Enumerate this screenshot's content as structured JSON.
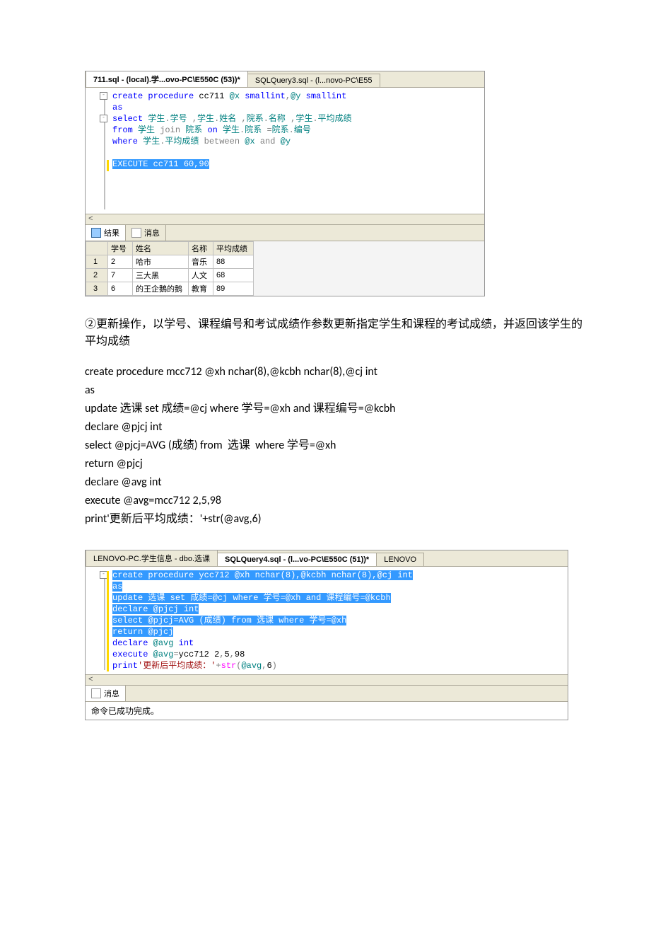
{
  "ssms1": {
    "tabs": {
      "active": "711.sql - (local).学...ovo-PC\\E550C (53))*",
      "inactive": "SQLQuery3.sql - (l...novo-PC\\E55"
    },
    "code": {
      "l1a": "create procedure",
      "l1b": " cc711 ",
      "l1c": "@x",
      "l1d": " smallint",
      "l1e": ",",
      "l1f": "@y",
      "l1g": " smallint",
      "l2": "as",
      "l3a": "select",
      "l3b": " 学生",
      "l3c": ".",
      "l3d": "学号",
      "l3e": " ,",
      "l3f": "学生",
      "l3g": ".",
      "l3h": "姓名",
      "l3i": " ,",
      "l3j": "院系",
      "l3k": ".",
      "l3l": "名称",
      "l3m": " ,",
      "l3n": "学生",
      "l3o": ".",
      "l3p": "平均成绩",
      "l4a": "from",
      "l4b": " 学生 ",
      "l4c": "join",
      "l4d": " 院系 ",
      "l4e": "on",
      "l4f": " 学生",
      "l4g": ".",
      "l4h": "院系 ",
      "l4i": "=",
      "l4j": "院系",
      "l4k": ".",
      "l4l": "编号",
      "l5a": "where",
      "l5b": " 学生",
      "l5c": ".",
      "l5d": "平均成绩 ",
      "l5e": "between",
      "l5f": " @x ",
      "l5g": "and",
      "l5h": " @y",
      "l7": "EXECUTE cc711 60,90"
    },
    "scroll_hint": "<",
    "results_tabs": {
      "results": "结果",
      "messages": "消息"
    },
    "grid": {
      "headers": {
        "row": "",
        "c1": "学号",
        "c2": "姓名",
        "c3": "名称",
        "c4": "平均成绩"
      },
      "rows": [
        {
          "n": "1",
          "c1": "2",
          "c2": "哈市",
          "c3": "音乐",
          "c4": "88"
        },
        {
          "n": "2",
          "c1": "7",
          "c2": "三大黑",
          "c3": "人文",
          "c4": "68"
        },
        {
          "n": "3",
          "c1": "6",
          "c2": "的王企鵝的鹅",
          "c3": "教育",
          "c4": "89"
        }
      ]
    }
  },
  "para1": "②更新操作，以学号、课程编号和考试成绩作参数更新指定学生和课程的考试成绩，并返回该学生的平均成绩",
  "code1": "create procedure mcc712 @xh nchar(8),@kcbh nchar(8),@cj int\nas\nupdate 选课 set 成绩=@cj where 学号=@xh and 课程编号=@kcbh\ndeclare @pjcj int\nselect @pjcj=AVG (成绩) from  选课  where 学号=@xh\nreturn @pjcj\ndeclare @avg int\nexecute @avg=mcc712 2,5,98\nprint'更新后平均成绩：'+str(@avg,6)",
  "ssms2": {
    "tabs": {
      "t1": "LENOVO-PC.学生信息 - dbo.选课",
      "active": "SQLQuery4.sql - (l...vo-PC\\E550C (51))*",
      "t3": "LENOVO"
    },
    "code": {
      "l1a": "create procedure",
      "l1b": " ycc712 ",
      "l1c": "@xh",
      "l1d": " nchar",
      "l1e": "(",
      "l1f": "8",
      "l1g": "),",
      "l1h": "@kcbh",
      "l1i": " nchar",
      "l1j": "(",
      "l1k": "8",
      "l1l": "),",
      "l1m": "@cj",
      "l1n": " int",
      "l2": "as",
      "l3a": "update",
      "l3b": " 选课 ",
      "l3c": "set",
      "l3d": " 成绩",
      "l3e": "=",
      "l3f": "@cj ",
      "l3g": "where",
      "l3h": " 学号",
      "l3i": "=",
      "l3j": "@xh ",
      "l3k": "and",
      "l3l": " 课程编号",
      "l3m": "=",
      "l3n": "@kcbh",
      "l4a": "declare",
      "l4b": " @pjcj ",
      "l4c": "int",
      "l5a": "select",
      "l5b": " @pjcj",
      "l5c": "=",
      "l5d": "AVG ",
      "l5e": "(",
      "l5f": "成绩",
      "l5g": ")",
      "l5h": " from",
      "l5i": " 选课 ",
      "l5j": "where",
      "l5k": " 学号",
      "l5l": "=",
      "l5m": "@xh",
      "l6a": "return",
      "l6b": " @pjcj",
      "l7a": "declare",
      "l7b": " @avg ",
      "l7c": "int",
      "l8a": "execute",
      "l8b": " @avg",
      "l8c": "=",
      "l8d": "ycc712 ",
      "l8e": "2",
      "l8f": ",",
      "l8g": "5",
      "l8h": ",",
      "l8i": "98",
      "l9a": "print",
      "l9b": "'更新后平均成绩：'",
      "l9c": "+",
      "l9d": "str",
      "l9e": "(",
      "l9f": "@avg",
      "l9g": ",",
      "l9h": "6",
      "l9i": ")"
    },
    "scroll_hint": "<",
    "results_tabs": {
      "messages": "消息"
    },
    "message": "命令已成功完成。"
  }
}
